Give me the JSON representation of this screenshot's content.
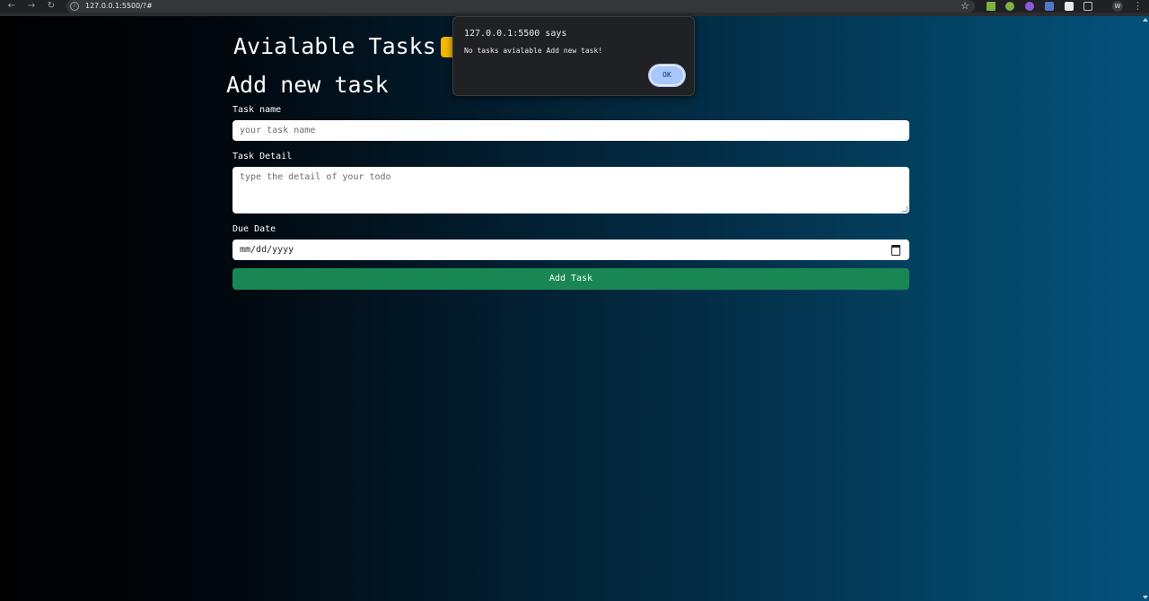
{
  "browser": {
    "url": "127.0.0.1:5500/?#",
    "profile_initial": "W",
    "nav": {
      "back": "←",
      "forward": "→",
      "reload": "↻"
    },
    "star": "☆",
    "menu": "⋮",
    "extension_colors": [
      "#7cb342",
      "#7cb342",
      "#8e5bd6",
      "#4f79c6",
      "#e8eaed",
      "#bdc1c6"
    ]
  },
  "page": {
    "title": "Avialable Tasks",
    "badge_color": "#f5b800",
    "form_heading": "Add new task",
    "task_name_label": "Task name",
    "task_name_placeholder": "your task name",
    "task_detail_label": "Task Detail",
    "task_detail_placeholder": "type the detail of your todo",
    "due_date_label": "Due Date",
    "due_date_placeholder": "mm/dd/yyyy",
    "add_button": "Add Task",
    "add_button_color": "#198754"
  },
  "dialog": {
    "title": "127.0.0.1:5500 says",
    "message": "No tasks avialable Add new task!",
    "ok_label": "OK"
  }
}
